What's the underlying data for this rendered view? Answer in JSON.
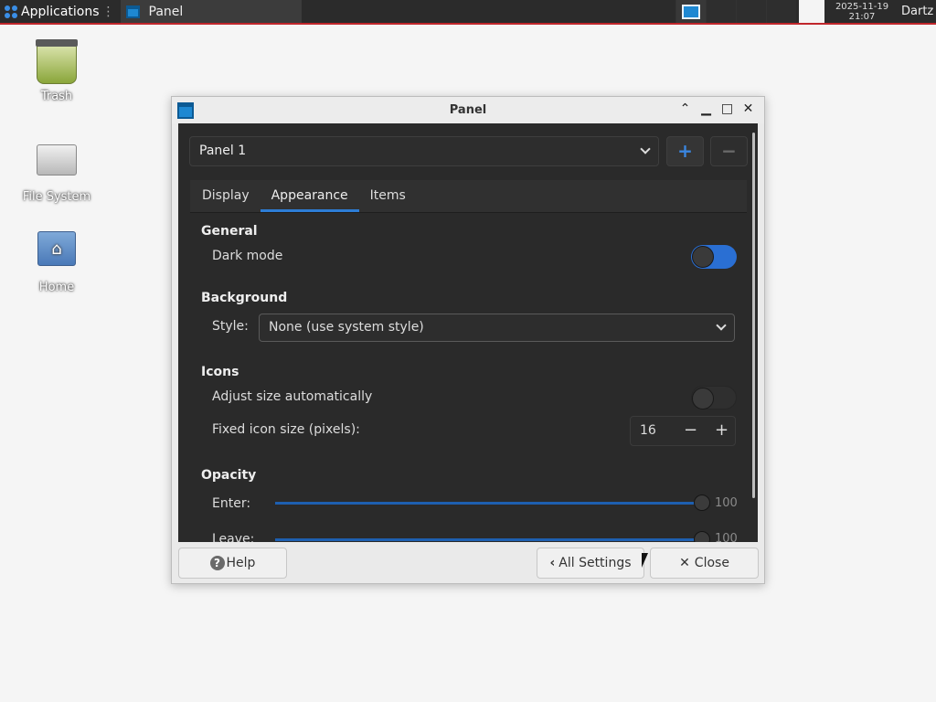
{
  "taskbar": {
    "apps_label": "Applications",
    "task_title": "Panel",
    "clock_date": "2025-11-19",
    "clock_time": "21:07",
    "user": "Dartz"
  },
  "desktop": {
    "icons": [
      {
        "label": "Trash"
      },
      {
        "label": "File System"
      },
      {
        "label": "Home"
      }
    ]
  },
  "window": {
    "title": "Panel",
    "panel_select": "Panel 1",
    "add_symbol": "+",
    "remove_symbol": "−",
    "tabs": [
      {
        "label": "Display"
      },
      {
        "label": "Appearance",
        "active": true
      },
      {
        "label": "Items"
      }
    ],
    "general": {
      "heading": "General",
      "dark_mode_label": "Dark mode",
      "dark_mode_on": true
    },
    "background": {
      "heading": "Background",
      "style_label": "Style:",
      "style_value": "None (use system style)"
    },
    "icons": {
      "heading": "Icons",
      "adjust_label": "Adjust size automatically",
      "adjust_on": false,
      "fixed_label": "Fixed icon size (pixels):",
      "fixed_value": "16"
    },
    "opacity": {
      "heading": "Opacity",
      "enter_label": "Enter:",
      "enter_value": "100",
      "leave_label": "Leave:",
      "leave_value": "100"
    },
    "buttons": {
      "help": "Help",
      "all_settings": "All Settings",
      "close": "Close"
    }
  },
  "colors": {
    "accent": "#2d7dd6",
    "taskbar_border": "#c0262b",
    "content_bg": "#2a2a2a"
  }
}
